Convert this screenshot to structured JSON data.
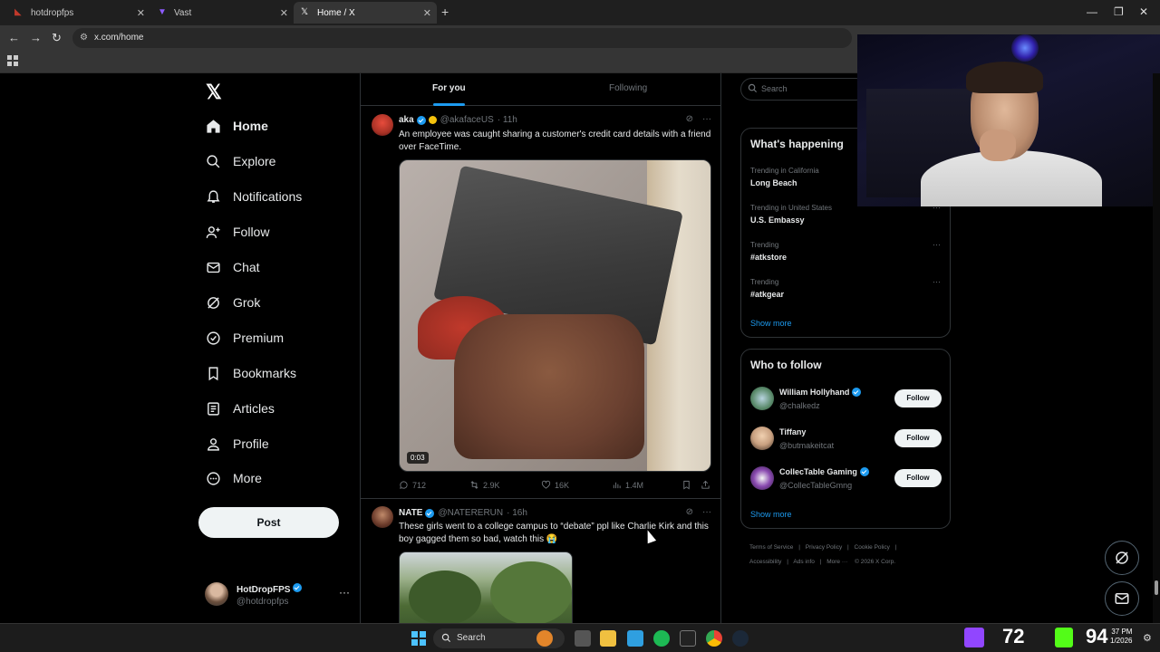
{
  "browser": {
    "tabs": [
      {
        "title": "hotdropfps",
        "active": false
      },
      {
        "title": "Vast",
        "active": false
      },
      {
        "title": "Home / X",
        "active": true
      }
    ],
    "url": "x.com/home"
  },
  "nav": {
    "items": [
      {
        "label": "Home",
        "icon": "home-icon"
      },
      {
        "label": "Explore",
        "icon": "search-icon"
      },
      {
        "label": "Notifications",
        "icon": "bell-icon"
      },
      {
        "label": "Follow",
        "icon": "person-add-icon"
      },
      {
        "label": "Chat",
        "icon": "mail-icon"
      },
      {
        "label": "Grok",
        "icon": "grok-icon"
      },
      {
        "label": "Premium",
        "icon": "premium-icon"
      },
      {
        "label": "Bookmarks",
        "icon": "bookmark-icon"
      },
      {
        "label": "Articles",
        "icon": "article-icon"
      },
      {
        "label": "Profile",
        "icon": "person-icon"
      },
      {
        "label": "More",
        "icon": "more-circle-icon"
      }
    ],
    "post_label": "Post",
    "account": {
      "name": "HotDropFPS",
      "handle": "@hotdropfps"
    }
  },
  "feed": {
    "tabs": [
      "For you",
      "Following"
    ],
    "tweets": [
      {
        "name": "aka",
        "handle": "@akafaceUS",
        "time": "· 11h",
        "text": "An employee was caught sharing a customer's credit card details with a friend over FaceTime.",
        "duration": "0:03",
        "replies": "712",
        "retweets": "2.9K",
        "likes": "16K",
        "views": "1.4M"
      },
      {
        "name": "NATE",
        "handle": "@NATERERUN",
        "time": "· 16h",
        "text": "These girls went to a college campus to “debate” ppl like Charlie Kirk and this boy gagged them so bad, watch this 😭"
      }
    ]
  },
  "sidebar": {
    "search_placeholder": "Search",
    "happening_title": "What's happening",
    "trends": [
      {
        "context": "Trending in California",
        "name": "Long Beach"
      },
      {
        "context": "Trending in United States",
        "name": "U.S. Embassy"
      },
      {
        "context": "Trending",
        "name": "#atkstore"
      },
      {
        "context": "Trending",
        "name": "#atkgear"
      }
    ],
    "show_more": "Show more",
    "who_to_follow_title": "Who to follow",
    "follow_suggestions": [
      {
        "name": "William Hollyhand",
        "handle": "@chalkedz",
        "verified": true
      },
      {
        "name": "Tiffany",
        "handle": "@butmakeitcat",
        "verified": false
      },
      {
        "name": "CollecTable Gaming",
        "handle": "@CollecTableGmng",
        "verified": true
      }
    ],
    "follow_label": "Follow",
    "footer": [
      "Terms of Service",
      "|",
      "Privacy Policy",
      "|",
      "Cookie Policy",
      "|",
      "Accessibility",
      "|",
      "Ads info",
      "|",
      "More ···",
      "© 2026 X Corp."
    ]
  },
  "taskbar": {
    "search_label": "Search",
    "overlay_left": "72",
    "overlay_right": "94",
    "clock_time": "37 PM",
    "clock_date": "1/2026"
  },
  "colors": {
    "accent": "#1d9bf0",
    "background": "#000000"
  }
}
